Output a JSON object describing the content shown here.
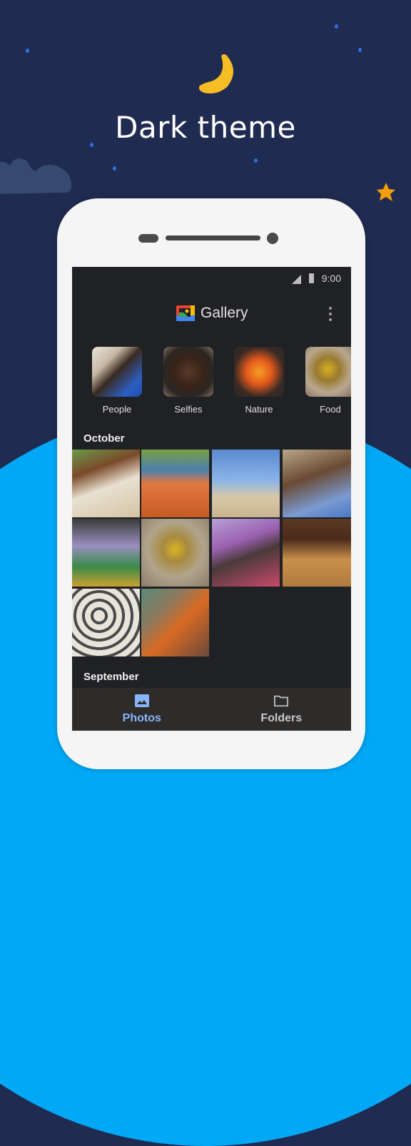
{
  "hero": {
    "title": "Dark theme"
  },
  "colors": {
    "background": "#202b51",
    "arc": "#00a8f5",
    "moon": "#f7bd24",
    "star": "#f59e0b",
    "accent": "#8ab4f8",
    "screen": "#202124"
  },
  "status_bar": {
    "time": "9:00",
    "icons": [
      "cell-signal-icon",
      "battery-icon"
    ]
  },
  "app_bar": {
    "title": "Gallery",
    "logo": "gallery-logo-icon",
    "menu": "more-vert-icon"
  },
  "albums": [
    {
      "label": "People"
    },
    {
      "label": "Selfies"
    },
    {
      "label": "Nature"
    },
    {
      "label": "Food"
    }
  ],
  "sections": [
    {
      "label": "October",
      "photos": [
        {
          "subject": "horse"
        },
        {
          "subject": "carrots and limes"
        },
        {
          "subject": "palm trees on beach"
        },
        {
          "subject": "smiling woman"
        },
        {
          "subject": "mural under bridge"
        },
        {
          "subject": "bowl of fruit"
        },
        {
          "subject": "mother with baby"
        },
        {
          "subject": "hands in grain"
        },
        {
          "subject": "street art faces"
        },
        {
          "subject": "market scene"
        }
      ]
    },
    {
      "label": "September",
      "photos": []
    }
  ],
  "bottom_nav": [
    {
      "label": "Photos",
      "icon": "photo-icon",
      "active": true
    },
    {
      "label": "Folders",
      "icon": "folder-icon",
      "active": false
    }
  ]
}
